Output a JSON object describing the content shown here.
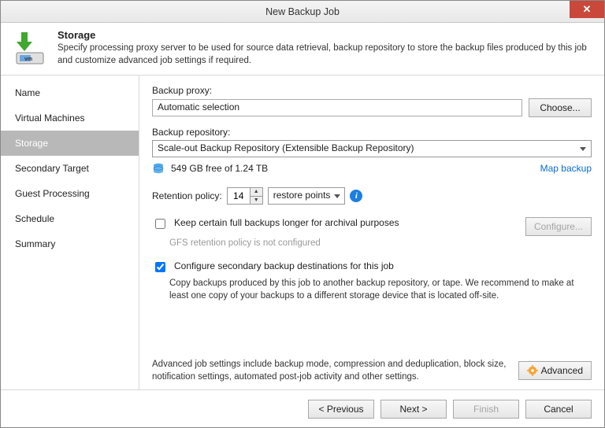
{
  "window": {
    "title": "New Backup Job"
  },
  "header": {
    "title": "Storage",
    "desc": "Specify processing proxy server to be used for source data retrieval, backup repository to store the backup files produced by this job and customize advanced job settings if required."
  },
  "sidebar": {
    "items": [
      {
        "label": "Name"
      },
      {
        "label": "Virtual Machines"
      },
      {
        "label": "Storage",
        "active": true
      },
      {
        "label": "Secondary Target"
      },
      {
        "label": "Guest Processing"
      },
      {
        "label": "Schedule"
      },
      {
        "label": "Summary"
      }
    ]
  },
  "content": {
    "backupProxyLabel": "Backup proxy:",
    "backupProxyValue": "Automatic selection",
    "chooseBtn": "Choose...",
    "backupRepoLabel": "Backup repository:",
    "backupRepoValue": "Scale-out Backup Repository (Extensible Backup Repository)",
    "freeSpace": "549 GB free of 1.24 TB",
    "mapBackup": "Map backup",
    "retentionLabel": "Retention policy:",
    "retentionValue": "14",
    "retentionUnit": "restore points",
    "keepFullLabel": "Keep certain full backups longer for archival purposes",
    "gfsNote": "GFS retention policy is not configured",
    "configureBtn": "Configure...",
    "secondaryLabel": "Configure secondary backup destinations for this job",
    "secondaryDesc": "Copy backups produced by this job to another backup repository, or tape. We recommend to make at least one copy of your backups to a different storage device that is located off-site.",
    "advancedDesc": "Advanced job settings include backup mode, compression and deduplication, block size, notification settings, automated post-job activity and other settings.",
    "advancedBtn": "Advanced"
  },
  "footer": {
    "previous": "< Previous",
    "next": "Next >",
    "finish": "Finish",
    "cancel": "Cancel"
  }
}
